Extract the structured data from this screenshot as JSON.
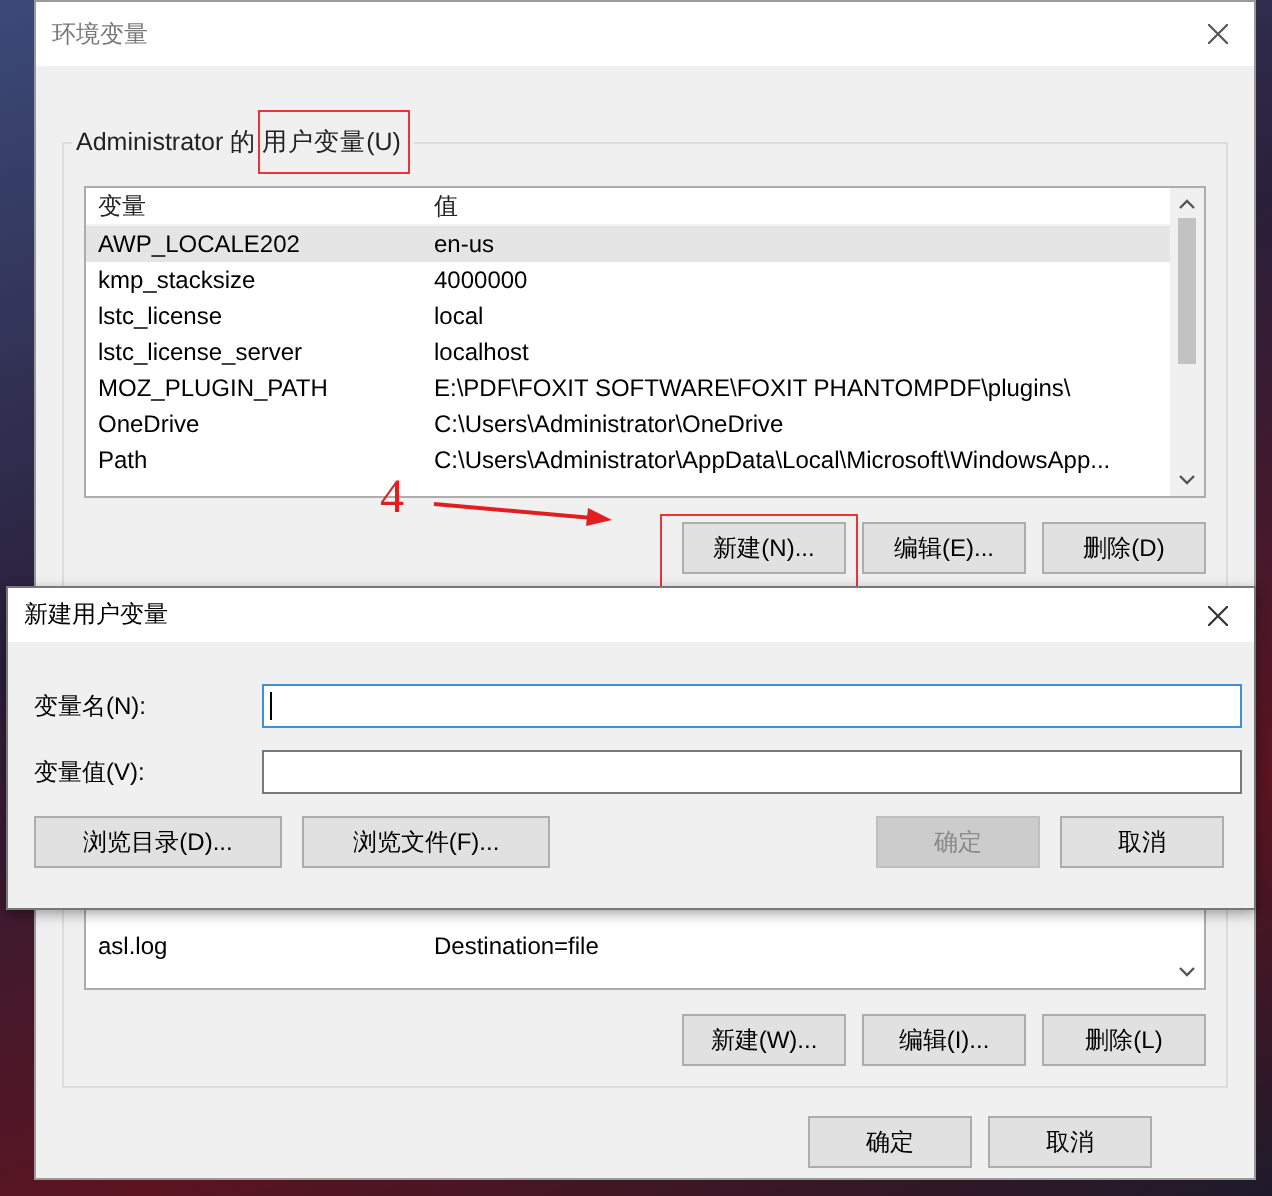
{
  "main_window": {
    "title": "环境变量",
    "user_variables": {
      "label_prefix": "Administrator 的",
      "label_highlight": "用户变量(U)",
      "columns": [
        "变量",
        "值"
      ],
      "rows": [
        {
          "name": "AWP_LOCALE202",
          "value": "en-us",
          "selected": true
        },
        {
          "name": "kmp_stacksize",
          "value": "4000000",
          "selected": false
        },
        {
          "name": "lstc_license",
          "value": "local",
          "selected": false
        },
        {
          "name": "lstc_license_server",
          "value": "localhost",
          "selected": false
        },
        {
          "name": "MOZ_PLUGIN_PATH",
          "value": "E:\\PDF\\FOXIT SOFTWARE\\FOXIT PHANTOMPDF\\plugins\\",
          "selected": false
        },
        {
          "name": "OneDrive",
          "value": "C:\\Users\\Administrator\\OneDrive",
          "selected": false
        },
        {
          "name": "Path",
          "value": "C:\\Users\\Administrator\\AppData\\Local\\Microsoft\\WindowsApp...",
          "selected": false
        }
      ],
      "buttons": [
        {
          "label": "新建(N)...",
          "highlighted": true
        },
        {
          "label": "编辑(E)...",
          "highlighted": false
        },
        {
          "label": "删除(D)",
          "highlighted": false
        }
      ]
    },
    "system_variables": {
      "rows": [
        {
          "name": "asl.log",
          "value": "Destination=file",
          "selected": false
        }
      ],
      "buttons": [
        "新建(W)...",
        "编辑(I)...",
        "删除(L)"
      ]
    },
    "footer_buttons": [
      "确定",
      "取消"
    ]
  },
  "annotation": {
    "step": "4"
  },
  "dialog": {
    "title": "新建用户变量",
    "fields": [
      {
        "label": "变量名(N):",
        "focused": true
      },
      {
        "label": "变量值(V):",
        "focused": false
      }
    ],
    "browse_buttons": [
      "浏览目录(D)...",
      "浏览文件(F)..."
    ],
    "buttons": [
      {
        "label": "确定",
        "disabled": true
      },
      {
        "label": "取消",
        "disabled": false
      }
    ]
  }
}
